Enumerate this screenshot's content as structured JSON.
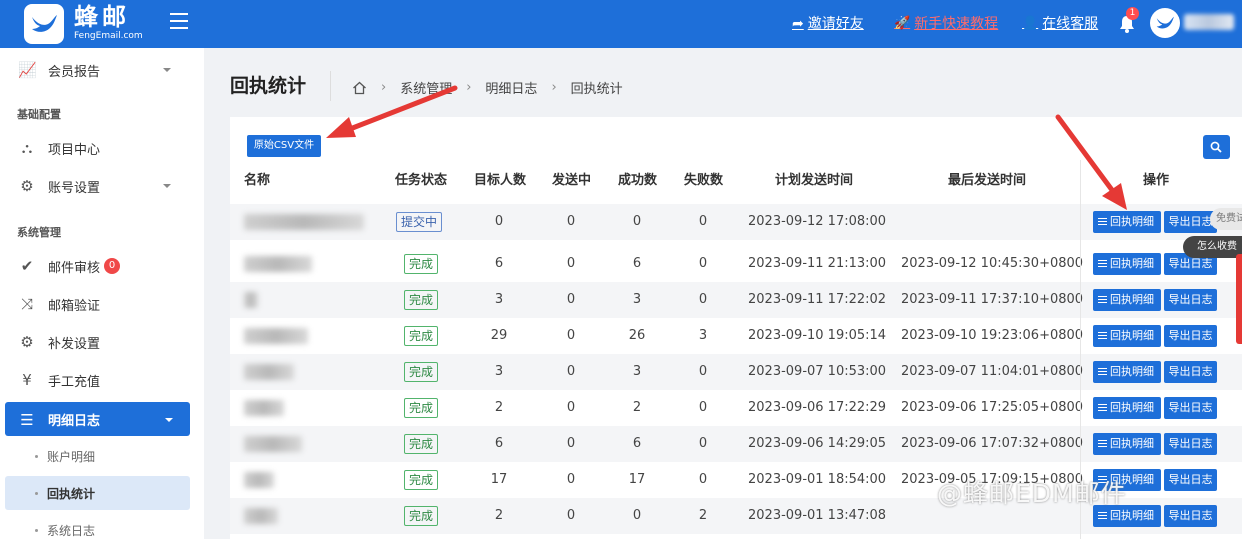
{
  "brand": {
    "title": "蜂邮",
    "subtitle": "FengEmail.com"
  },
  "topbar": {
    "invite": "邀请好友",
    "tutorial": "新手快速教程",
    "support": "在线客服",
    "bell_count": "1"
  },
  "sidebar": {
    "member_report": "会员报告",
    "section_basic": "基础配置",
    "project_center": "项目中心",
    "account_settings": "账号设置",
    "section_system": "系统管理",
    "mail_review": "邮件审核",
    "mail_review_badge": "0",
    "mailbox_verify": "邮箱验证",
    "resend_settings": "补发设置",
    "manual_recharge": "手工充值",
    "detail_log": "明细日志",
    "sub_account_detail": "账户明细",
    "sub_receipt_stats": "回执统计",
    "sub_system_log": "系统日志"
  },
  "page": {
    "title": "回执统计",
    "breadcrumb": [
      "系统管理",
      "明细日志",
      "回执统计"
    ]
  },
  "toolbar": {
    "csv_button": "原始CSV文件"
  },
  "table": {
    "headers": {
      "name": "名称",
      "status": "任务状态",
      "target": "目标人数",
      "sending": "发送中",
      "success": "成功数",
      "failed": "失败数",
      "planned_time": "计划发送时间",
      "last_time": "最后发送时间",
      "ops": "操作"
    },
    "detail_btn": "回执明细",
    "export_btn": "导出日志",
    "rows": [
      {
        "status": "提交中",
        "target": "0",
        "sending": "0",
        "success": "0",
        "failed": "0",
        "planned": "2023-09-12 17:08:00",
        "last": ""
      },
      {
        "status": "完成",
        "target": "6",
        "sending": "0",
        "success": "6",
        "failed": "0",
        "planned": "2023-09-11 21:13:00",
        "last": "2023-09-12 10:45:30+0800"
      },
      {
        "status": "完成",
        "target": "3",
        "sending": "0",
        "success": "3",
        "failed": "0",
        "planned": "2023-09-11 17:22:02",
        "last": "2023-09-11 17:37:10+0800"
      },
      {
        "status": "完成",
        "target": "29",
        "sending": "0",
        "success": "26",
        "failed": "3",
        "planned": "2023-09-10 19:05:14",
        "last": "2023-09-10 19:23:06+0800"
      },
      {
        "status": "完成",
        "target": "3",
        "sending": "0",
        "success": "3",
        "failed": "0",
        "planned": "2023-09-07 10:53:00",
        "last": "2023-09-07 11:04:01+0800"
      },
      {
        "status": "完成",
        "target": "2",
        "sending": "0",
        "success": "2",
        "failed": "0",
        "planned": "2023-09-06 17:22:29",
        "last": "2023-09-06 17:25:05+0800"
      },
      {
        "status": "完成",
        "target": "6",
        "sending": "0",
        "success": "6",
        "failed": "0",
        "planned": "2023-09-06 14:29:05",
        "last": "2023-09-06 17:07:32+0800"
      },
      {
        "status": "完成",
        "target": "17",
        "sending": "0",
        "success": "17",
        "failed": "0",
        "planned": "2023-09-01 18:54:00",
        "last": "2023-09-05 17:09:15+0800"
      },
      {
        "status": "完成",
        "target": "2",
        "sending": "0",
        "success": "0",
        "failed": "2",
        "planned": "2023-09-01 13:47:08",
        "last": ""
      }
    ]
  },
  "floating": {
    "tab_bottom": "怎么收费",
    "tab_top": "免费试"
  },
  "watermark": "@蜂邮EDM邮件",
  "colors": {
    "brand_blue": "#1e6fd9",
    "done_green": "#2f8a45",
    "arrow_red": "#e53935"
  }
}
